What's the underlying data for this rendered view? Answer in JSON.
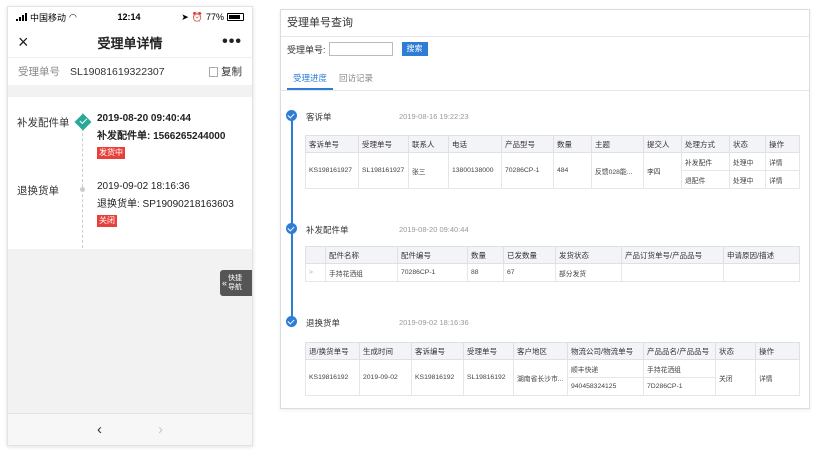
{
  "phone": {
    "status": {
      "carrier": "中国移动",
      "time": "12:14",
      "battery": "77%"
    },
    "nav": {
      "close_icon": "×",
      "title": "受理单详情",
      "more_icon": "•••"
    },
    "order": {
      "label": "受理单号",
      "value": "SL19081619322307",
      "copy": "复制"
    },
    "timeline": [
      {
        "name": "补发配件单",
        "time": "2019-08-20   09:40:44",
        "desc": "补发配件单:    1566265244000",
        "badge": "发货中"
      },
      {
        "name": "退换货单",
        "time": "2019-09-02    18:16:36",
        "desc": "退换货单:    SP19090218163603",
        "badge": "关闭"
      }
    ],
    "float_nav": {
      "line1": "快捷",
      "line2": "导航"
    },
    "bottom": {
      "back": "‹",
      "forward": "›"
    }
  },
  "panel": {
    "title": "受理单号查询",
    "search": {
      "label": "受理单号:",
      "value": "",
      "button": "搜索"
    },
    "tabs": [
      "受理进度",
      "回访记录"
    ],
    "sections": [
      {
        "title": "客诉单",
        "time": "2019-08-16 19:22:23",
        "headers": [
          "客诉单号",
          "受理单号",
          "联系人",
          "电话",
          "产品型号",
          "数量",
          "主题",
          "提交人",
          "处理方式",
          "状态",
          "操作"
        ],
        "rows": [
          [
            "KS198161927",
            "SL198161927",
            "张三",
            "13800138000",
            "70286CP-1",
            "484",
            "反馈028能...",
            "李四",
            "补发配件",
            "处理中",
            "详情"
          ],
          [
            "",
            "",
            "",
            "",
            "",
            "",
            "",
            "",
            "退配件",
            "处理中",
            "详情"
          ]
        ]
      },
      {
        "title": "补发配件单",
        "time": "2019-08-20 09:40:44",
        "headers": [
          "",
          "配件名称",
          "配件编号",
          "数量",
          "已发数量",
          "发货状态",
          "产品订货单号/产品品号",
          "申请原因/描述"
        ],
        "rows": [
          [
            ">",
            "手持花洒组",
            "70286CP-1",
            "88",
            "67",
            "部分发货",
            "",
            ""
          ]
        ]
      },
      {
        "title": "退换货单",
        "time": "2019-09-02 18:16:36",
        "headers": [
          "退/换货单号",
          "生成时间",
          "客诉编号",
          "受理单号",
          "客户地区",
          "物流公司/物流单号",
          "产品品名/产品品号",
          "状态",
          "操作"
        ],
        "rows": [
          [
            "KS19816192",
            "2019-09-02",
            "KS19816192",
            "SL19816192",
            "湖南省长沙市...",
            "顺丰快递",
            "手持花洒组",
            "关闭",
            "详情"
          ],
          [
            "",
            "",
            "",
            "",
            "",
            "940458324125",
            "7D286CP-1",
            "",
            ""
          ]
        ]
      }
    ]
  },
  "colors": {
    "accent": "#2d7cd6",
    "success": "#2aa89a",
    "danger": "#e8403a"
  }
}
